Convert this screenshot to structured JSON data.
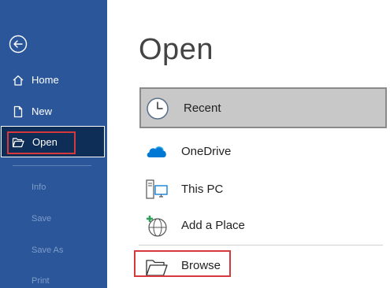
{
  "sidebar": {
    "back_icon": "back-arrow-icon",
    "items": [
      {
        "label": "Home",
        "icon": "home-icon"
      },
      {
        "label": "New",
        "icon": "new-document-icon"
      },
      {
        "label": "Open",
        "icon": "open-folder-icon",
        "selected": true
      }
    ],
    "disabled_items": [
      "Info",
      "Save",
      "Save As",
      "Print"
    ]
  },
  "main": {
    "title": "Open",
    "locations": [
      {
        "label": "Recent",
        "icon": "clock-icon",
        "selected": true
      },
      {
        "label": "OneDrive",
        "icon": "onedrive-cloud-icon"
      },
      {
        "label": "This PC",
        "icon": "computer-icon"
      },
      {
        "label": "Add a Place",
        "icon": "add-place-globe-icon"
      }
    ],
    "browse": {
      "label": "Browse",
      "icon": "folder-icon"
    }
  },
  "colors": {
    "sidebar": "#2b579a",
    "sidebar_selected": "#0f2e57",
    "highlight": "#d6383b",
    "recent_bg": "#c8c8c8",
    "onedrive": "#0078d4"
  }
}
